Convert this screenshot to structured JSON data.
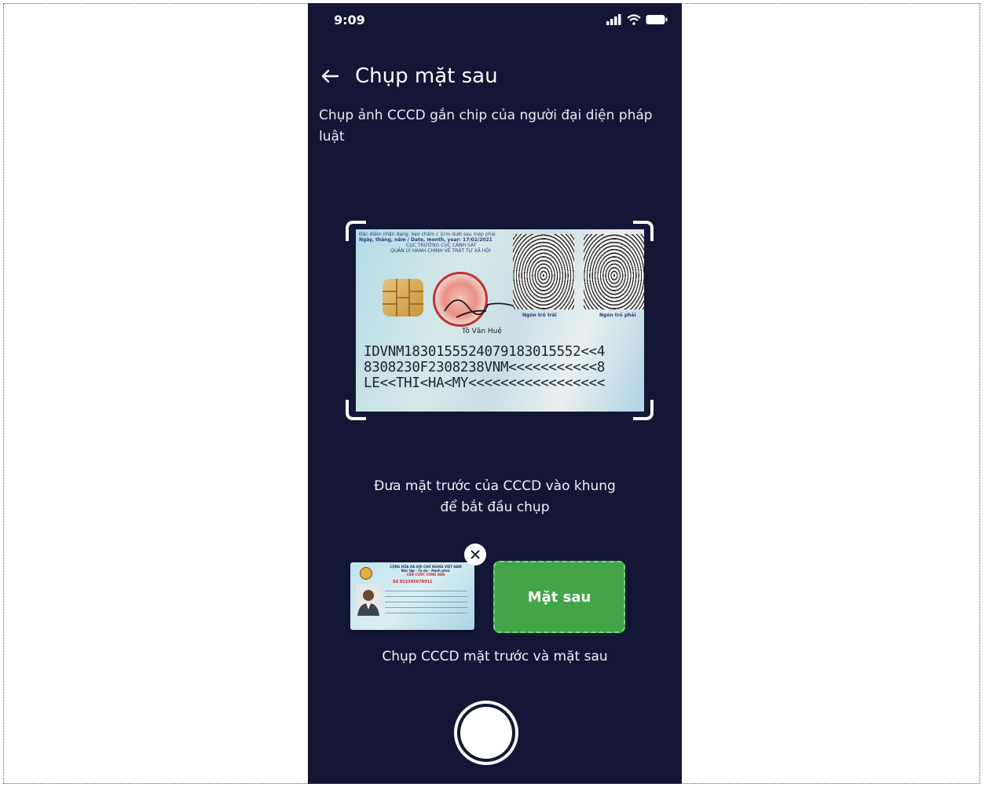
{
  "status_bar": {
    "time": "9:09",
    "icons": [
      "signal-icon",
      "wifi-icon",
      "battery-icon"
    ]
  },
  "header": {
    "back_icon": "arrow-left-icon",
    "title": "Chụp mặt sau"
  },
  "subtitle": "Chụp ảnh CCCD gắn chip của người đại diện pháp luật",
  "id_card_back": {
    "header_lines": [
      "Đặc điểm nhận dạng: Sẹo chấm c 2cm dưới sau mép phải",
      "Ngày, tháng, năm / Date, month, year: 17/02/2021",
      "CỤC TRƯỞNG CỤC CẢNH SÁT",
      "QUẢN LÝ HÀNH CHÍNH VỀ TRẬT TỰ XÃ HỘI"
    ],
    "signer": "Tô Văn Huệ",
    "left_finger_label": "Ngón trỏ trái",
    "right_finger_label": "Ngón trỏ phải",
    "mrz_lines": [
      "IDVNM1830155524079183015552<<4",
      "8308230F2308238VNM<<<<<<<<<<<8",
      "LE<<THI<HA<MY<<<<<<<<<<<<<<<<<"
    ]
  },
  "instruction": [
    "Đưa mặt trước của CCCD vào khung",
    "để bắt đầu chụp"
  ],
  "thumbnail_front": {
    "header_lines": [
      "CỘNG HÒA XÃ HỘI CHỦ NGHĨA VIỆT NAM",
      "Độc lập - Tự do - Hạnh phúc",
      "CĂN CƯỚC CÔNG DÂN"
    ],
    "number": "Số 012345678911",
    "close_icon": "close-icon"
  },
  "back_slot_label": "Mặt sau",
  "thumb_caption": "Chụp CCCD mặt trước và mặt sau",
  "colors": {
    "background": "#131735",
    "accent_green": "#43a547",
    "white": "#ffffff"
  }
}
